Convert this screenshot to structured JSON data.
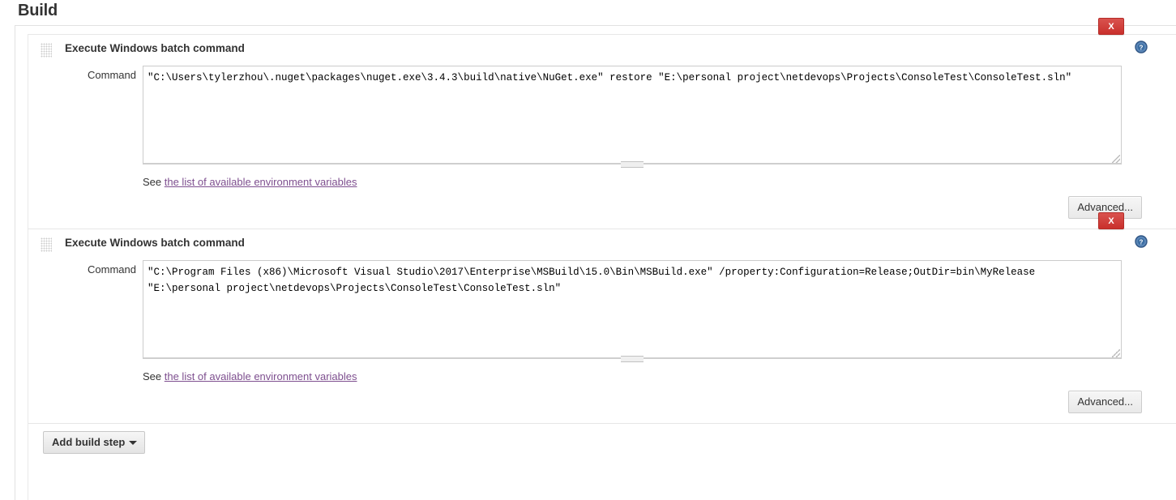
{
  "page": {
    "title": "Build"
  },
  "build_steps": [
    {
      "title": "Execute Windows batch command",
      "delete_label": "X",
      "help_icon": "help-circle-icon",
      "field_label": "Command",
      "command": "\"C:\\Users\\tylerzhou\\.nuget\\packages\\nuget.exe\\3.4.3\\build\\native\\NuGet.exe\" restore \"E:\\personal project\\netdevops\\Projects\\ConsoleTest\\ConsoleTest.sln\"",
      "env_prefix": "See ",
      "env_link": "the list of available environment variables",
      "advanced_label": "Advanced..."
    },
    {
      "title": "Execute Windows batch command",
      "delete_label": "X",
      "help_icon": "help-circle-icon",
      "field_label": "Command",
      "command": "\"C:\\Program Files (x86)\\Microsoft Visual Studio\\2017\\Enterprise\\MSBuild\\15.0\\Bin\\MSBuild.exe\" /property:Configuration=Release;OutDir=bin\\MyRelease\n\"E:\\personal project\\netdevops\\Projects\\ConsoleTest\\ConsoleTest.sln\"",
      "env_prefix": "See ",
      "env_link": "the list of available environment variables",
      "advanced_label": "Advanced..."
    }
  ],
  "footer": {
    "add_build_step_label": "Add build step",
    "caret_icon": "chevron-down-icon"
  },
  "colors": {
    "delete_button": "#c9302c",
    "help_icon": "#3b6ea5",
    "link": "#7e4f8f",
    "text": "#333333"
  }
}
